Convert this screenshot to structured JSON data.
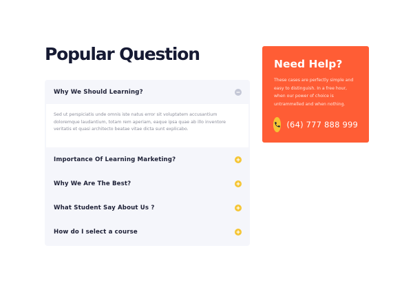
{
  "page_title": "Popular Question",
  "faq": {
    "items": [
      {
        "question": "Why We Should Learning?",
        "expanded": true,
        "icon": "minus-icon",
        "answer": "Sed ut perspiciatis unde omnis iste natus error sit voluptatem accusantium doloremque laudantium, totam rem aperiam, eaque ipsa quae ab illo inventore veritatis et quasi architecto beatae vitae dicta sunt explicabo."
      },
      {
        "question": "Importance Of Learning Marketing?",
        "expanded": false,
        "icon": "plus-icon"
      },
      {
        "question": "Why We Are The Best?",
        "expanded": false,
        "icon": "plus-icon"
      },
      {
        "question": "What Student Say About Us ?",
        "expanded": false,
        "icon": "plus-icon"
      },
      {
        "question": "How do I select a course",
        "expanded": false,
        "icon": "plus-icon"
      }
    ]
  },
  "help": {
    "title": "Need Help?",
    "text": "These cases are perfectly simple and easy to distinguish. In a free hour, when our power of choice is untrammelled and when nothing.",
    "phone": "(64) 777 888 999",
    "phone_icon": "phone-icon"
  },
  "colors": {
    "accent_orange": "#ff5d35",
    "accent_yellow": "#f5c534",
    "heading": "#161a33",
    "panel_bg": "#f5f6fb"
  }
}
